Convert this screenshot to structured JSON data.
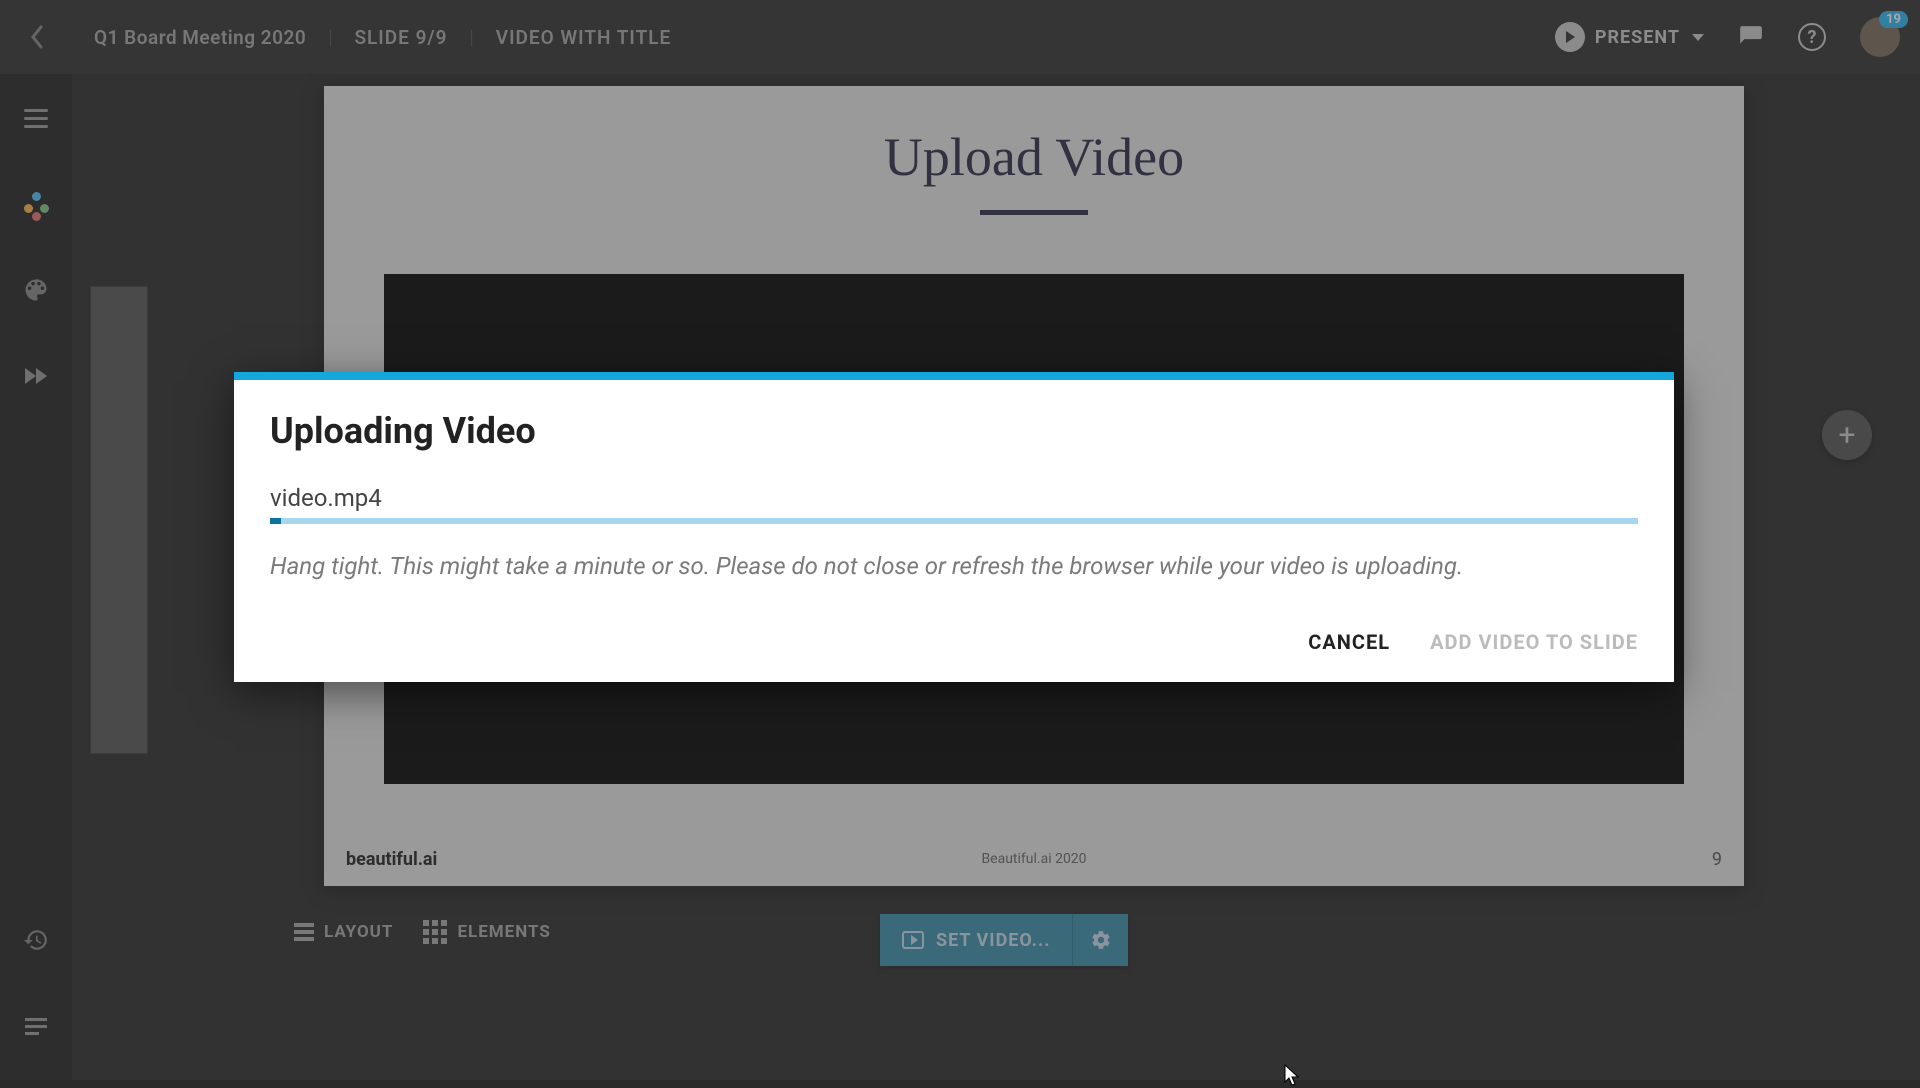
{
  "header": {
    "doc_title": "Q1 Board Meeting 2020",
    "slide_indicator": "SLIDE 9/9",
    "slide_type": "VIDEO WITH TITLE",
    "present_label": "PRESENT",
    "notification_count": "19"
  },
  "slide": {
    "title": "Upload Video",
    "brand": "beautiful.ai",
    "footer_center": "Beautiful.ai 2020",
    "page_number": "9"
  },
  "toolbar": {
    "layout_label": "LAYOUT",
    "elements_label": "ELEMENTS",
    "set_video_label": "SET VIDEO..."
  },
  "modal": {
    "title": "Uploading Video",
    "filename": "video.mp4",
    "hint": "Hang tight. This might take a minute or so. Please do not close or refresh the browser while your video is uploading.",
    "cancel_label": "CANCEL",
    "add_label": "ADD VIDEO TO SLIDE",
    "progress_percent": 0.8
  }
}
